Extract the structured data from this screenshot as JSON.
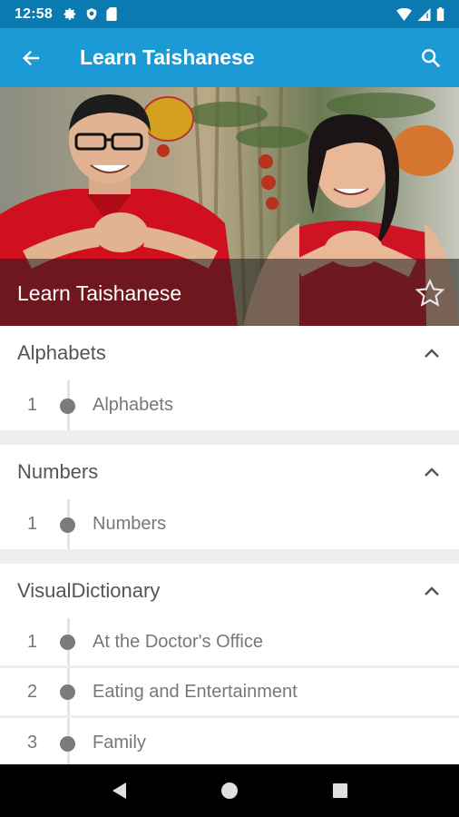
{
  "status_bar": {
    "time": "12:58",
    "left_icons": [
      "gear-icon",
      "shield-icon",
      "sim-card-icon"
    ],
    "right_icons": [
      "wifi-icon",
      "signal-icon",
      "battery-icon"
    ]
  },
  "app_bar": {
    "title": "Learn Taishanese",
    "back_icon": "arrow-left-icon",
    "search_icon": "search-icon",
    "background": "#1c9ad6"
  },
  "hero": {
    "title": "Learn Taishanese",
    "favorite_icon": "star-outline-icon"
  },
  "sections": [
    {
      "title": "Alphabets",
      "expanded": true,
      "lessons": [
        {
          "number": "1",
          "label": "Alphabets"
        }
      ]
    },
    {
      "title": "Numbers",
      "expanded": true,
      "lessons": [
        {
          "number": "1",
          "label": "Numbers"
        }
      ]
    },
    {
      "title": "VisualDictionary",
      "expanded": true,
      "lessons": [
        {
          "number": "1",
          "label": "At the Doctor's Office"
        },
        {
          "number": "2",
          "label": "Eating and Entertainment"
        },
        {
          "number": "3",
          "label": "Family"
        }
      ]
    }
  ],
  "nav_bar": {
    "buttons": [
      "back-triangle-icon",
      "home-circle-icon",
      "recents-square-icon"
    ]
  }
}
